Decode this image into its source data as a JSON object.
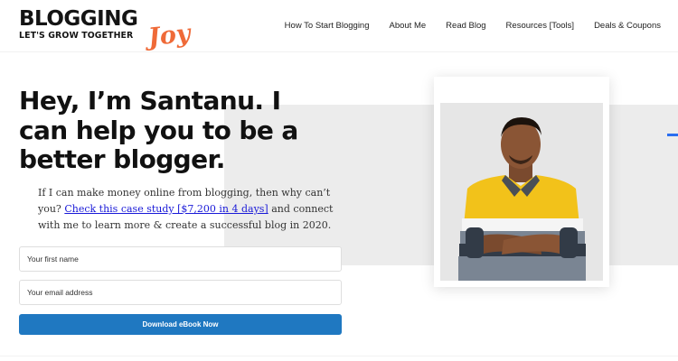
{
  "logo": {
    "main": "BLOGGING",
    "tagline": "LET'S GROW TOGETHER",
    "accent": "Joy",
    "accent_color": "#ef6a38"
  },
  "nav": {
    "items": [
      {
        "label": "How To Start Blogging"
      },
      {
        "label": "About Me"
      },
      {
        "label": "Read Blog"
      },
      {
        "label": "Resources [Tools]"
      },
      {
        "label": "Deals & Coupons"
      }
    ]
  },
  "hero": {
    "headline": "Hey, I’m Santanu. I can help you to be a better blogger.",
    "intro_before": "If I can make money online from blogging, then why can’t you?",
    "intro_link": "Check this case study [$7,200 in 4 days]",
    "intro_after": " and connect with me to learn more & create a successful blog in 2020."
  },
  "form": {
    "first_name_placeholder": "Your first name",
    "email_placeholder": "Your email address",
    "submit_label": "Download eBook Now",
    "button_color": "#1f78c1"
  },
  "photo": {
    "icon": "profile-photo"
  }
}
